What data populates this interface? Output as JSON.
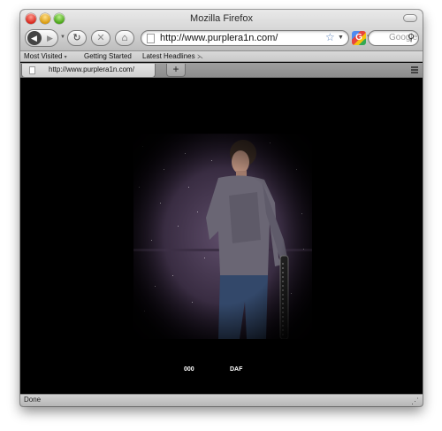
{
  "window": {
    "title": "Mozilla Firefox"
  },
  "toolbar": {
    "url": "http://www.purplera1n.com/",
    "search_placeholder": "Google",
    "search_engine_letter": "G"
  },
  "bookmarks": [
    {
      "label": "Most Visited",
      "has_dropdown": true
    },
    {
      "label": "Getting Started",
      "has_dropdown": false
    },
    {
      "label": "Latest Headlines",
      "has_feed_icon": true
    }
  ],
  "tabs": [
    {
      "label": "http://www.purplera1n.com/",
      "active": true
    }
  ],
  "page": {
    "image": "photo of a person standing in rain holding a phone dock",
    "caption_left": "000",
    "caption_right": "DAF"
  },
  "status": {
    "text": "Done"
  },
  "colors": {
    "page_background": "#000000",
    "photo_tint": "#5b4a66"
  }
}
